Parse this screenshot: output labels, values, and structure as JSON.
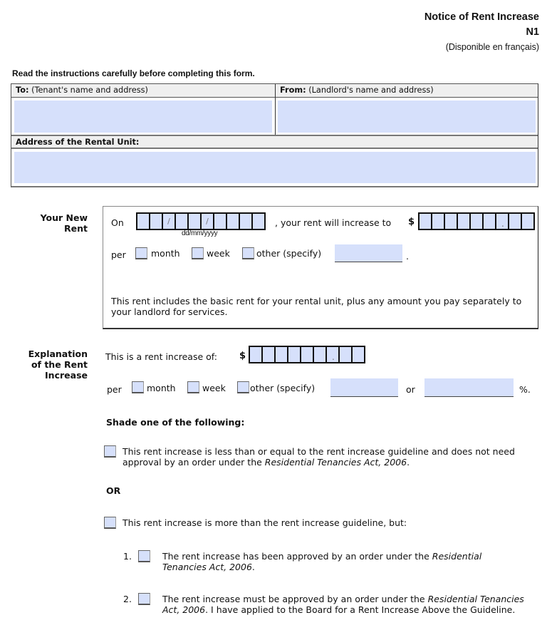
{
  "header": {
    "title": "Notice of Rent Increase",
    "form_code": "N1",
    "french_note": "(Disponible en français)"
  },
  "instructions": "Read the instructions carefully before completing this form.",
  "parties": {
    "to_label_bold": "To:",
    "to_label_rest": " (Tenant's name and address)",
    "to_value": "",
    "from_label_bold": "From:",
    "from_label_rest": " (Landlord's name and address)",
    "from_value": "",
    "address_label": "Address of the Rental Unit:",
    "address_value": ""
  },
  "new_rent": {
    "section_label_line1": "Your New",
    "section_label_line2": "Rent",
    "on_label": "On",
    "date_cells": [
      "",
      "",
      "/",
      "",
      "",
      "/",
      "",
      "",
      "",
      ""
    ],
    "date_format_hint": "dd/mm/yyyy",
    "increase_to_label": ", your rent will increase to",
    "currency_symbol": "$",
    "amount_cells": [
      "",
      "",
      "",
      "",
      "",
      "",
      ".",
      "",
      ""
    ],
    "per_label": "per",
    "period_options": [
      {
        "label": "month",
        "checked": false
      },
      {
        "label": "week",
        "checked": false
      },
      {
        "label": "other (specify)",
        "checked": false
      }
    ],
    "other_value": "",
    "trailing_period": ".",
    "includes_text": "This rent includes the basic rent for your rental unit, plus any amount you pay separately to your landlord for services."
  },
  "explanation": {
    "section_label_line1": "Explanation",
    "section_label_line2": "of the Rent",
    "section_label_line3": "Increase",
    "increase_of_label": "This is a rent increase of:",
    "currency_symbol": "$",
    "amount_cells": [
      "",
      "",
      "",
      "",
      "",
      "",
      ".",
      "",
      ""
    ],
    "per_label": "per",
    "period_options": [
      {
        "label": "month",
        "checked": false
      },
      {
        "label": "week",
        "checked": false
      },
      {
        "label": "other (specify)",
        "checked": false
      }
    ],
    "other_value": "",
    "or_label": "or",
    "percent_value": "",
    "percent_suffix": "%.",
    "shade_heading": "Shade one of the following:",
    "option_a_text": "This rent increase is less than or equal to the rent increase guideline and does not need approval by an order under the ",
    "option_a_italic": "Residential Tenancies Act, 2006",
    "option_a_end": ".",
    "or_separator": "OR",
    "option_b_text": "This rent increase is more than the rent increase guideline, but:",
    "sub_options": [
      {
        "number": "1.",
        "text": "The rent increase has been approved by an order under the ",
        "italic": "Residential Tenancies Act, 2006",
        "end": "."
      },
      {
        "number": "2.",
        "text": "The rent increase must be approved by an order under the ",
        "italic": "Residential Tenancies Act, 2006",
        "end": ". I have applied to the Board for a Rent Increase Above the Guideline."
      }
    ]
  }
}
